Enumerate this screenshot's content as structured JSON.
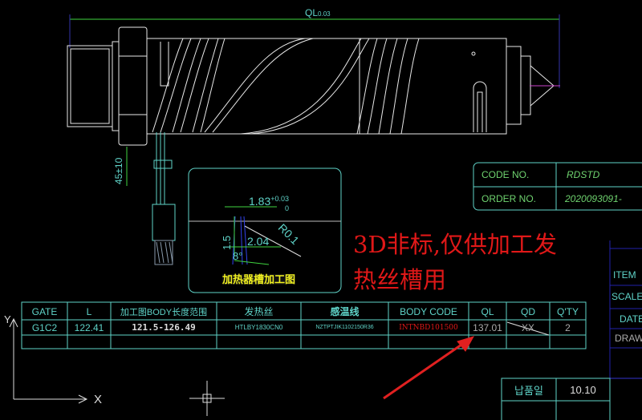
{
  "drawing": {
    "overall_dim": {
      "label": "QL",
      "tolerance": "0.03"
    },
    "wire_dim": "45±10",
    "detail": {
      "title": "加热器槽加工图",
      "dim_width": "1.83",
      "dim_tol_upper": "+0.03",
      "dim_tol_lower": "0",
      "dim_bottom": "2.04",
      "dim_depth": "1.5",
      "dim_radius": "R0.1",
      "dim_angle": "8°"
    },
    "annotation": [
      "3D非标,仅供加工发",
      "热丝槽用"
    ]
  },
  "code_box": {
    "rows": [
      {
        "label": "CODE NO.",
        "value": "RDSTD"
      },
      {
        "label": "ORDER NO.",
        "value": "2020093091-"
      }
    ]
  },
  "spec_table": {
    "headers": [
      "GATE",
      "L",
      "加工图BODY长度范围",
      "发热丝",
      "感温线",
      "BODY CODE",
      "QL",
      "QD",
      "Q'TY"
    ],
    "row": [
      "G1C2",
      "122.41",
      "121.5-126.49",
      "HTLBY1830CN0",
      "NZTPTJIK1102150R36",
      "INTNBD101500",
      "137.01",
      "XX",
      "2"
    ]
  },
  "title_block": {
    "labels": [
      "ITEM",
      "SCALE",
      "DATE",
      "DRAW"
    ]
  },
  "date_table": {
    "label": "납품일",
    "value": "10.10"
  },
  "ucs": {
    "x": "X",
    "y": "Y"
  },
  "colors": {
    "cyan": "#5fd3c8",
    "green": "#6fd36f",
    "red": "#e01818",
    "yellow": "#f0f020"
  }
}
